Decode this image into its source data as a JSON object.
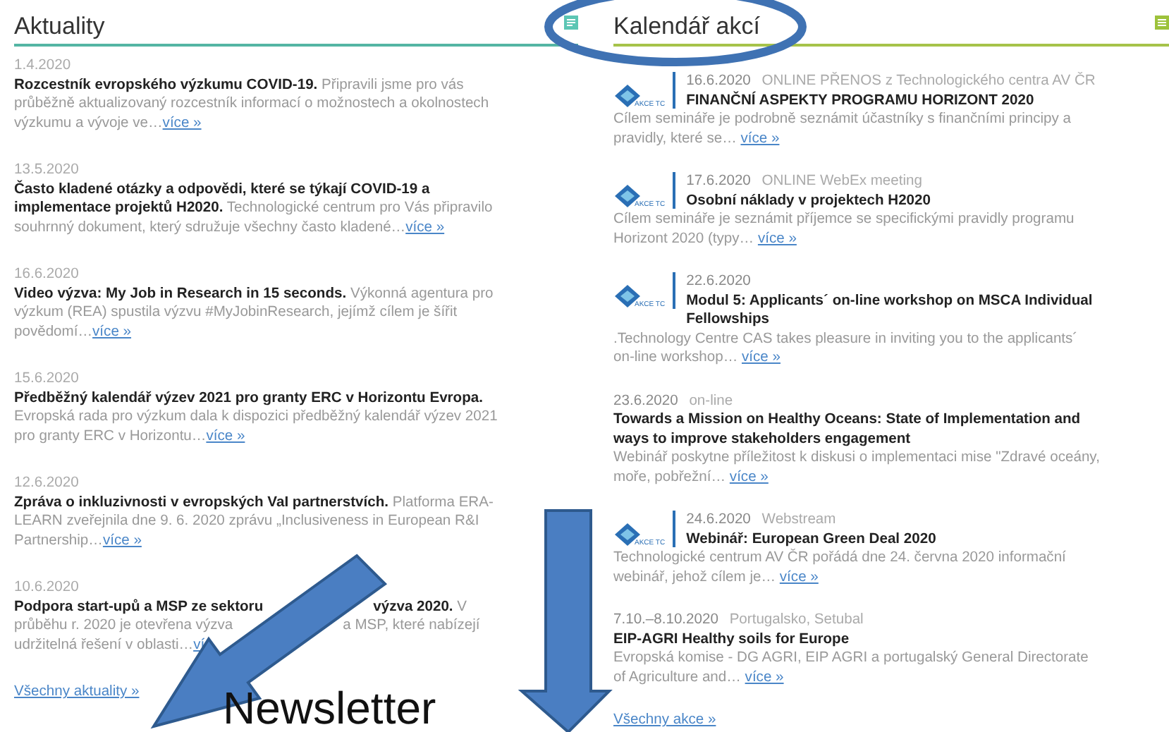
{
  "news": {
    "title": "Aktuality",
    "items": [
      {
        "date": "1.4.2020",
        "parts": [
          "**Rozcestník evropského výzkumu COVID-19.** Připravili jsme pro vás průběžně aktualizovaný rozcestník informací o možnostech a okolnostech výzkumu a vývoje ve…"
        ],
        "more": "více »"
      },
      {
        "date": "13.5.2020",
        "parts": [
          "**Často kladené otázky a odpovědi, které se týkají COVID-19 a implementace projektů H2020.** Technologické centrum pro Vás připravilo souhrnný dokument, který sdružuje všechny často kladené…"
        ],
        "more": "více »"
      },
      {
        "date": "16.6.2020",
        "parts": [
          "**Video výzva: My Job in Research in 15 seconds.** Výkonná agentura pro výzkum (REA) spustila výzvu #MyJobinResearch, jejímž cílem je šířit povědomí…"
        ],
        "more": "více »"
      },
      {
        "date": "15.6.2020",
        "parts": [
          "**Předběžný kalendář výzev 2021 pro granty ERC v Horizontu Evropa.** Evropská rada pro výzkum dala k dispozici předběžný kalendář výzev 2021 pro granty ERC v Horizontu…"
        ],
        "more": "více »"
      },
      {
        "date": "12.6.2020",
        "parts": [
          "**Zpráva o inkluzivnosti v evropských VaI partnerstvích.** Platforma ERA-LEARN zveřejnila dne 9. 6. 2020 zprávu „Inclusiveness in European R&I Partnership…"
        ],
        "more": "více »"
      },
      {
        "date": "10.6.2020",
        "parts": [
          "**Podpora start-upů a MSP ze sektoru**",
          "**výzva 2020.** V průběhu r. 2020 je otevřena výzva",
          "a MSP, které nabízejí udržitelná řešení v oblasti…"
        ],
        "more": "ví"
      }
    ],
    "all_link": "Všechny aktuality »"
  },
  "events": {
    "title": "Kalendář akcí",
    "items": [
      {
        "kind": "logo",
        "logo_text": "AKCE TC",
        "date": "16.6.2020",
        "place": "ONLINE PŘENOS z Technologického centra AV ČR",
        "title": "FINANČNÍ ASPEKTY PROGRAMU HORIZONT 2020",
        "body": "Cílem semináře je podrobně seznámit účastníky s finančními principy a pravidly, které se…",
        "more": "více »"
      },
      {
        "kind": "logo",
        "logo_text": "AKCE TC",
        "date": "17.6.2020",
        "place": "ONLINE WebEx meeting",
        "title": "Osobní náklady v projektech H2020",
        "body": "Cílem semináře je seznámit příjemce se specifickými pravidly programu Horizont 2020 (typy…",
        "more": "více »"
      },
      {
        "kind": "logo",
        "logo_text": "AKCE TC",
        "date": "22.6.2020",
        "title": "Modul 5: Applicants´ on-line workshop on MSCA Individual Fellowships",
        "body": ".Technology Centre CAS takes pleasure in inviting you to the applicants´ on-line workshop…",
        "more": "více »"
      },
      {
        "kind": "plain",
        "date": "23.6.2020",
        "place": "on-line",
        "title": "Towards a Mission on Healthy Oceans: State of Implementation and ways to improve stakeholders engagement",
        "body": "Webinář poskytne příležitost k diskusi o implementaci mise \"Zdravé oceány, moře, pobřežní…",
        "more": "více »"
      },
      {
        "kind": "logo",
        "logo_text": "AKCE TC",
        "date": "24.6.2020",
        "place": "Webstream",
        "title": "Webinář: European Green Deal 2020",
        "body": "Technologické centrum AV ČR pořádá dne 24. června 2020 informační webinář, jehož cílem je…",
        "more": "více »"
      },
      {
        "kind": "plain",
        "date": "7.10.–8.10.2020",
        "place": "Portugalsko, Setubal",
        "title": "EIP-AGRI Healthy soils for Europe",
        "body": "Evropská komise - DG AGRI, EIP AGRI a portugalský General Directorate of Agriculture and…",
        "more": "více »"
      }
    ],
    "all_link": "Všechny akce »"
  },
  "annotation": {
    "caption": "Newsletter"
  }
}
